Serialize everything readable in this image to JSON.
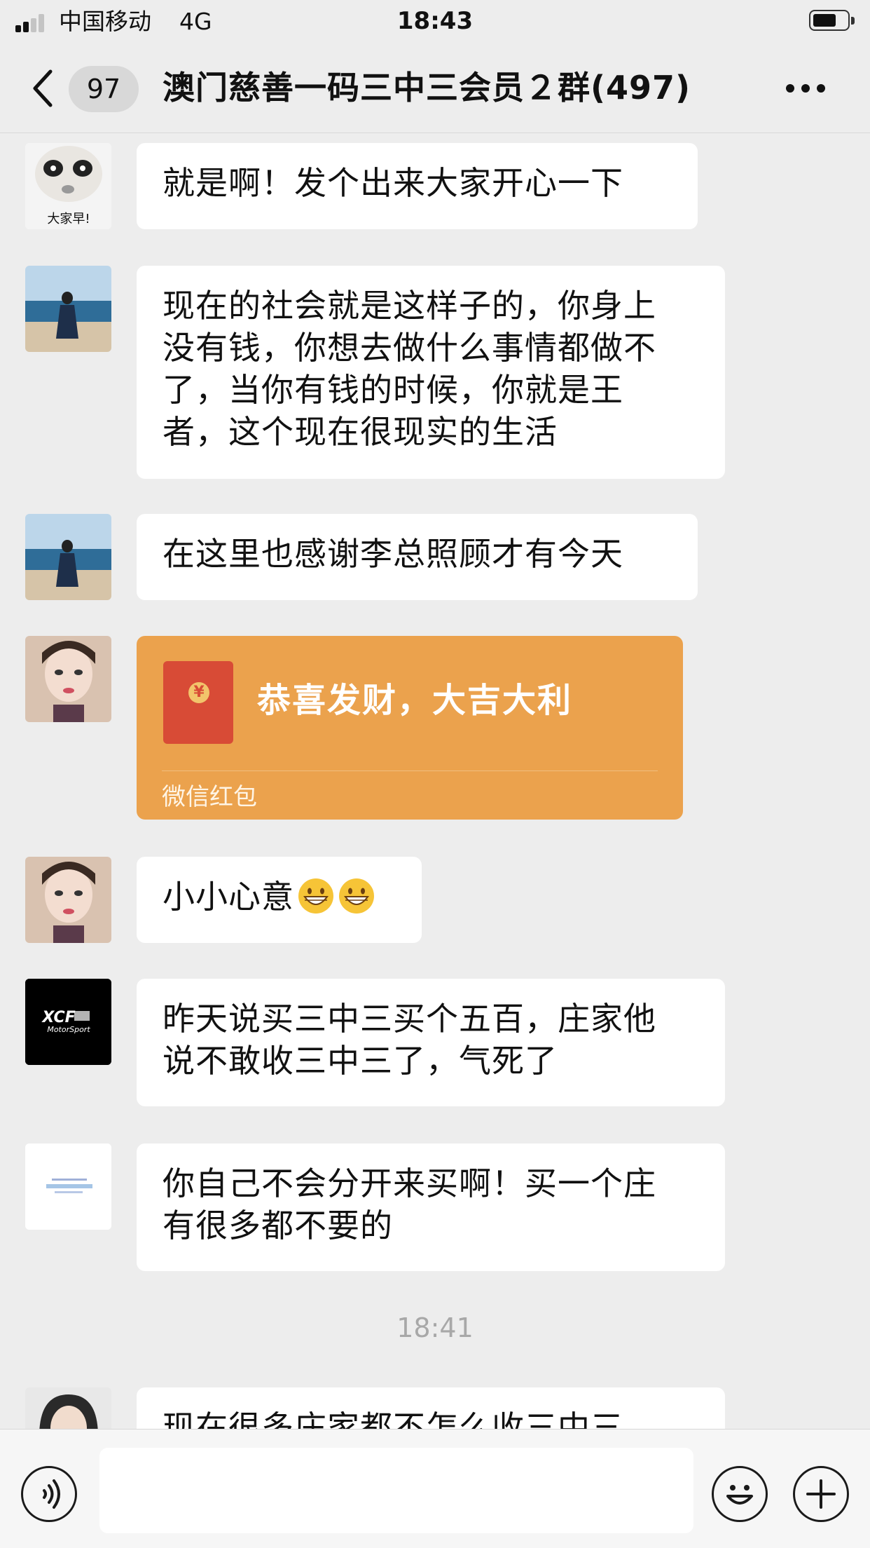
{
  "status_bar": {
    "carrier": "中国移动",
    "network": "4G",
    "time": "18:43",
    "signal_bars_active": 2,
    "battery_icon": "battery-icon"
  },
  "nav": {
    "back_icon": "chevron-left-icon",
    "unread_count": "97",
    "title": "澳门慈善一码三中三会员２群(497)",
    "more_icon": "more-dots-icon"
  },
  "messages": [
    {
      "avatar": "cartoon-face-avatar",
      "avatar_caption": "大家早!",
      "text": "就是啊！发个出来大家开心一下"
    },
    {
      "avatar": "beach-woman-avatar",
      "lines": [
        "现在的社会就是这样子的，你身上",
        "没有钱，你想去做什么事情都做不",
        "了，当你有钱的时候，你就是王",
        "者，这个现在很现实的生活"
      ]
    },
    {
      "avatar": "beach-woman-avatar",
      "text": "在这里也感谢李总照顾才有今天"
    },
    {
      "avatar": "selfie-woman-avatar",
      "type": "red_packet",
      "title": "恭喜发财，大吉大利",
      "label": "微信红包",
      "coin_symbol": "¥"
    },
    {
      "avatar": "selfie-woman-avatar",
      "text": "小小心意",
      "emojis": [
        "grinning-emoji",
        "grinning-emoji"
      ]
    },
    {
      "avatar": "xcf-motorsport-avatar",
      "avatar_logo": "XCF",
      "avatar_logo_sub": "MotorSport",
      "lines": [
        "昨天说买三中三买个五百，庄家他",
        "说不敢收三中三了，气死了"
      ]
    },
    {
      "avatar": "white-text-avatar",
      "lines": [
        "你自己不会分开来买啊！买一个庄",
        "有很多都不要的"
      ]
    },
    {
      "avatar": "portrait-woman-avatar",
      "text": "现在很多庄家都不怎么收三中三"
    }
  ],
  "timestamp": "18:41",
  "input_bar": {
    "voice_icon": "voice-icon",
    "emoji_icon": "smiley-icon",
    "plus_icon": "plus-icon",
    "input_value": ""
  },
  "colors": {
    "background": "#ededed",
    "bubble": "#ffffff",
    "red_packet": "#eba24d",
    "envelope": "#d84b36"
  }
}
